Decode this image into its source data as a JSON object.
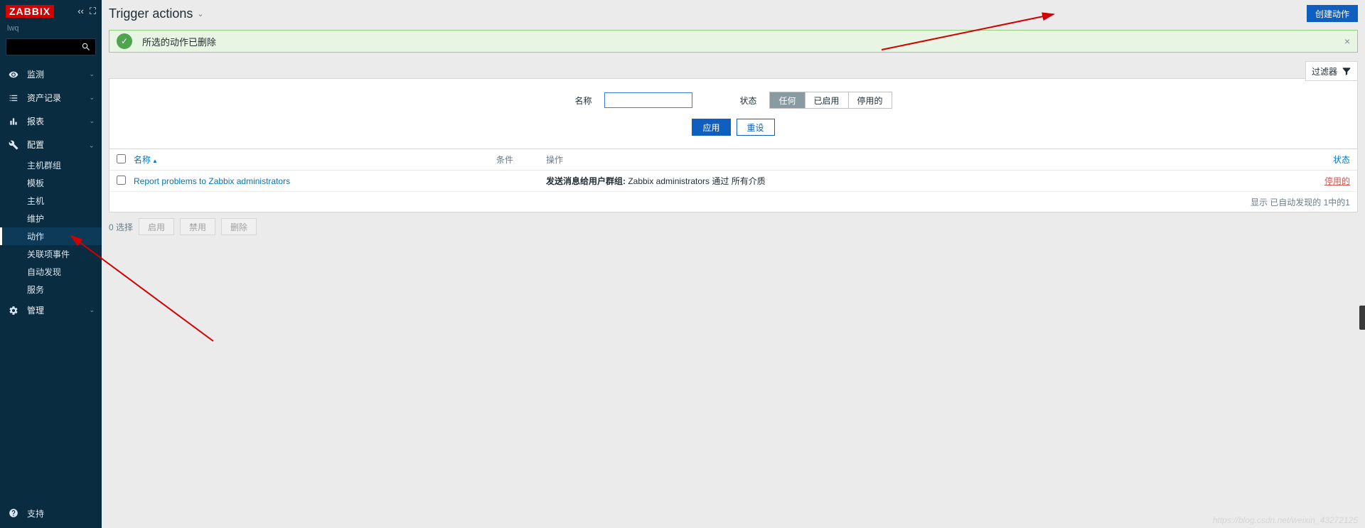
{
  "brand": "ZABBIX",
  "user": "lwq",
  "sidebar": {
    "items": [
      {
        "icon": "eye",
        "label": "监测",
        "expanded": false
      },
      {
        "icon": "list",
        "label": "资产记录",
        "expanded": false
      },
      {
        "icon": "bar",
        "label": "报表",
        "expanded": false
      },
      {
        "icon": "wrench",
        "label": "配置",
        "expanded": true,
        "children": [
          {
            "label": "主机群组"
          },
          {
            "label": "模板"
          },
          {
            "label": "主机"
          },
          {
            "label": "维护"
          },
          {
            "label": "动作",
            "active": true
          },
          {
            "label": "关联项事件"
          },
          {
            "label": "自动发现"
          },
          {
            "label": "服务"
          }
        ]
      },
      {
        "icon": "gear",
        "label": "管理",
        "expanded": false
      }
    ],
    "support": "支持"
  },
  "page": {
    "title": "Trigger actions",
    "create_btn": "创建动作"
  },
  "alert": {
    "message": "所选的动作已删除"
  },
  "filter": {
    "toggle_label": "过滤器",
    "name_label": "名称",
    "name_value": "",
    "status_label": "状态",
    "status_options": [
      "任何",
      "已启用",
      "停用的"
    ],
    "status_selected": 0,
    "apply": "应用",
    "reset": "重设"
  },
  "table": {
    "headers": {
      "name": "名称",
      "conditions": "条件",
      "operations": "操作",
      "status": "状态"
    },
    "rows": [
      {
        "name": "Report problems to Zabbix administrators",
        "conditions": "",
        "op_bold": "发送消息给用户群组:",
        "op_rest": " Zabbix administrators 通过 所有介质",
        "status": "停用的"
      }
    ],
    "footer": "显示 已自动发现的 1中的1"
  },
  "bulk": {
    "selected_prefix": "0 选择",
    "enable": "启用",
    "disable": "禁用",
    "delete": "删除"
  },
  "watermark": "https://blog.csdn.net/weixin_43272125"
}
